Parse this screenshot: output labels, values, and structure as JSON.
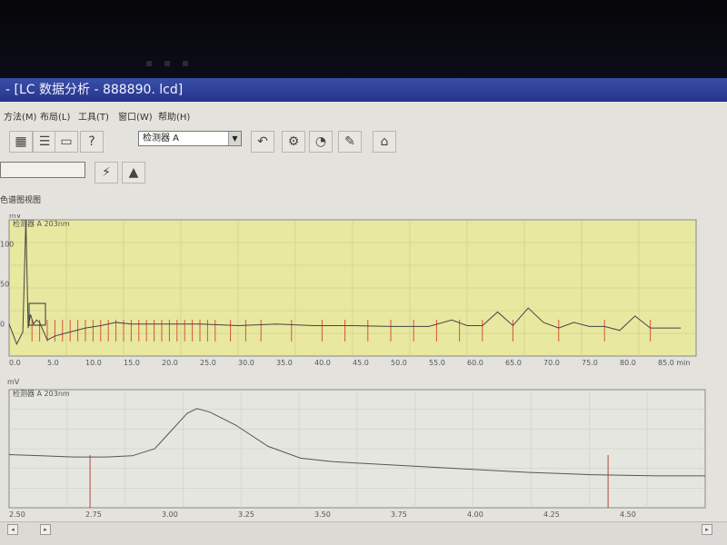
{
  "window": {
    "title": "- [LC 数据分析 - 888890. lcd]"
  },
  "menu": [
    "方法(M)",
    "布局(L)",
    "工具(T)",
    "窗口(W)",
    "帮助(H)"
  ],
  "toolbar": {
    "help_glyph": "?",
    "detector_value": "检测器 A"
  },
  "panel": {
    "title": "色谱图视图"
  },
  "chart_data": [
    {
      "type": "line",
      "title": "检测器 A 203nm",
      "ylabel": "mV",
      "y_ticks": [
        "100",
        "50",
        "0"
      ],
      "x_ticks": [
        "0.0",
        "5.0",
        "10.0",
        "15.0",
        "20.0",
        "25.0",
        "30.0",
        "35.0",
        "40.0",
        "45.0",
        "50.0",
        "55.0",
        "60.0",
        "65.0",
        "70.0",
        "75.0",
        "80.0",
        "85.0 min"
      ],
      "xlim": [
        0,
        90
      ],
      "ylim": [
        -40,
        130
      ],
      "series": [
        {
          "x": [
            0,
            1,
            1.8,
            2.2,
            2.5,
            2.8,
            3.2,
            3.6,
            4,
            5,
            6,
            8,
            10,
            12,
            14,
            16,
            20,
            25,
            30,
            35,
            40,
            45,
            50,
            55,
            58,
            60,
            62,
            64,
            66,
            68,
            70,
            72,
            74,
            76,
            78,
            80,
            82,
            84,
            86,
            88
          ],
          "values": [
            0,
            -25,
            -10,
            130,
            -5,
            12,
            0,
            5,
            2,
            -20,
            -15,
            -10,
            -5,
            -2,
            2,
            0,
            0,
            0,
            -2,
            0,
            -2,
            -2,
            -3,
            -3,
            5,
            -2,
            -2,
            15,
            -2,
            20,
            2,
            -5,
            2,
            -3,
            -3,
            -8,
            10,
            -5,
            -5,
            -5
          ]
        }
      ],
      "markers_x": [
        3,
        4,
        5,
        6,
        7,
        8,
        9,
        10,
        11,
        12,
        13,
        14,
        15,
        16,
        17,
        18,
        19,
        20,
        21,
        22,
        23,
        24,
        25,
        26,
        27,
        29,
        31,
        33,
        37,
        41,
        44,
        47,
        50,
        53,
        56,
        59,
        62,
        66,
        72,
        78,
        84
      ]
    },
    {
      "type": "line",
      "title": "检测器 A 203nm",
      "ylabel": "mV",
      "x_ticks": [
        "2.50",
        "2.75",
        "3.00",
        "3.25",
        "3.50",
        "3.75",
        "4.00",
        "4.25",
        "4.50"
      ],
      "xlim": [
        2.5,
        4.65
      ],
      "ylim": [
        0,
        10
      ],
      "series": [
        {
          "x": [
            2.5,
            2.6,
            2.7,
            2.8,
            2.88,
            2.95,
            3.0,
            3.05,
            3.08,
            3.12,
            3.2,
            3.3,
            3.4,
            3.5,
            3.7,
            3.9,
            4.1,
            4.3,
            4.5,
            4.65
          ],
          "values": [
            4.5,
            4.4,
            4.3,
            4.3,
            4.4,
            5.0,
            6.5,
            8.0,
            8.4,
            8.1,
            7.0,
            5.2,
            4.2,
            3.9,
            3.6,
            3.3,
            3.0,
            2.8,
            2.7,
            2.7
          ]
        }
      ],
      "markers_x": [
        2.75,
        4.35
      ]
    }
  ]
}
